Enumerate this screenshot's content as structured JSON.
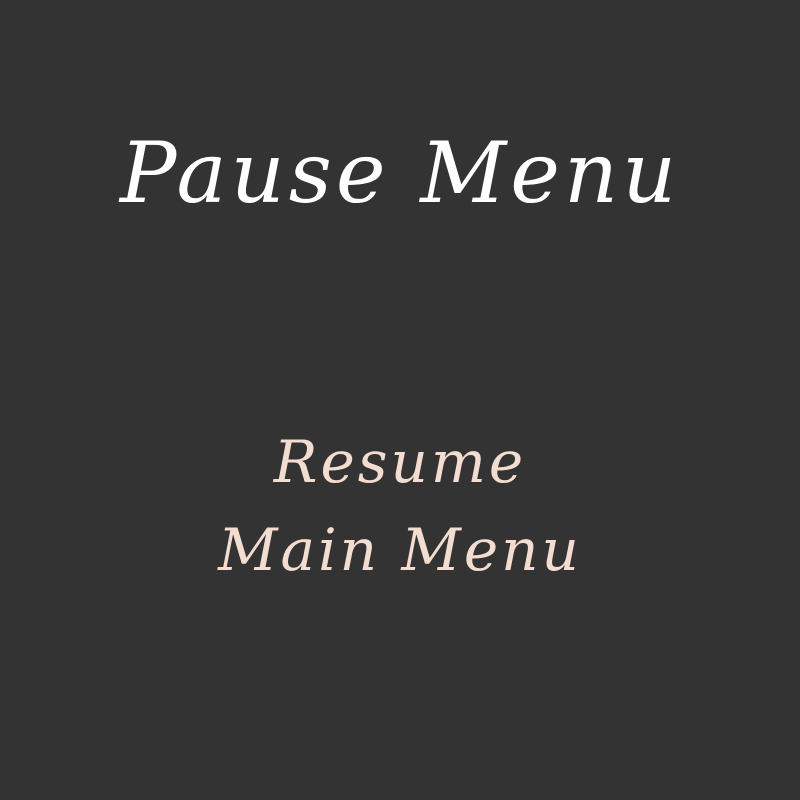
{
  "pause_menu": {
    "title": "Pause Menu",
    "items": [
      {
        "label": "Resume"
      },
      {
        "label": "Main Menu"
      }
    ]
  },
  "colors": {
    "background": "#333333",
    "title": "#ffffff",
    "menu_item": "#f3ddd0"
  }
}
